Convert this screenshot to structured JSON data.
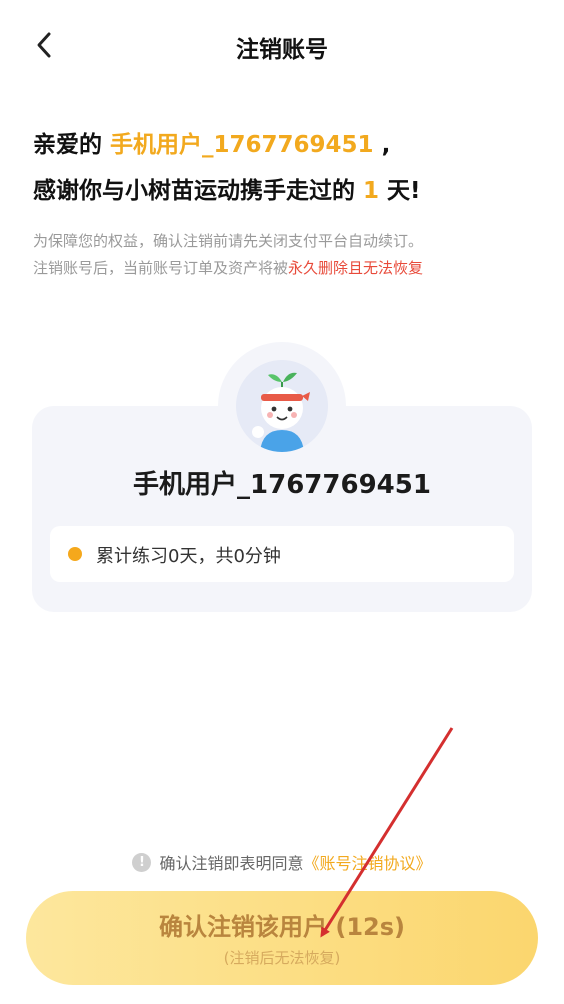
{
  "header": {
    "title": "注销账号"
  },
  "greeting": {
    "prefix": "亲爱的 ",
    "username": "手机用户_1767769451",
    "suffix": " ,",
    "line2_prefix": "感谢你与小树苗运动携手走过的 ",
    "days": "1",
    "line2_suffix": " 天!"
  },
  "notice": {
    "line1": "为保障您的权益，确认注销前请先关闭支付平台自动续订。",
    "line2_prefix": "注销账号后，当前账号订单及资产将被",
    "line2_warning": "永久删除且无法恢复"
  },
  "profile": {
    "username": "手机用户_1767769451",
    "stats": "累计练习0天，共0分钟"
  },
  "agreement": {
    "text": "确认注销即表明同意",
    "link": "《账号注销协议》"
  },
  "confirm": {
    "label": "确认注销该用户 (12s)",
    "sub": "(注销后无法恢复)"
  },
  "colors": {
    "accent": "#f2a91e",
    "warning": "#e84a3a",
    "button_start": "#fde79d",
    "button_end": "#fbd66e",
    "arrow": "#d42f2f"
  },
  "icons": {
    "back": "chevron-left-icon",
    "info": "info-circle-icon",
    "avatar": "sprout-mascot"
  }
}
